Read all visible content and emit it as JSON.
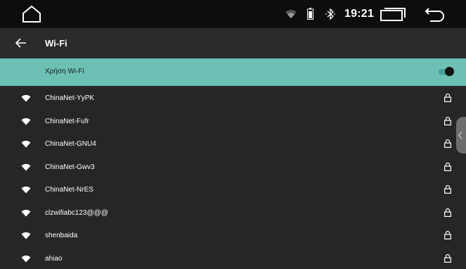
{
  "status_bar": {
    "time": "19:21",
    "icons": [
      "home-icon",
      "wifi-signal-icon",
      "battery-icon",
      "bluetooth-icon",
      "recents-icon",
      "back-icon"
    ]
  },
  "header": {
    "title": "Wi-Fi",
    "back_icon": "arrow-left-icon"
  },
  "wifi_toggle": {
    "label": "Χρήση Wi-Fi",
    "enabled": true
  },
  "networks": [
    {
      "ssid": "ChinaNet-YyPK",
      "secured": true
    },
    {
      "ssid": "ChinaNet-Fufr",
      "secured": true
    },
    {
      "ssid": "ChinaNet-GNU4",
      "secured": true
    },
    {
      "ssid": "ChinaNet-Gwv3",
      "secured": true
    },
    {
      "ssid": "ChinaNet-NrES",
      "secured": true
    },
    {
      "ssid": "clzwifiabc123@@@",
      "secured": true
    },
    {
      "ssid": "shenbaida",
      "secured": true
    },
    {
      "ssid": "ahiao",
      "secured": true
    }
  ],
  "colors": {
    "status_bar_bg": "#0d0d0d",
    "title_bar_bg": "#2b2b2b",
    "list_bg": "#262626",
    "accent": "#6cc0b4"
  }
}
